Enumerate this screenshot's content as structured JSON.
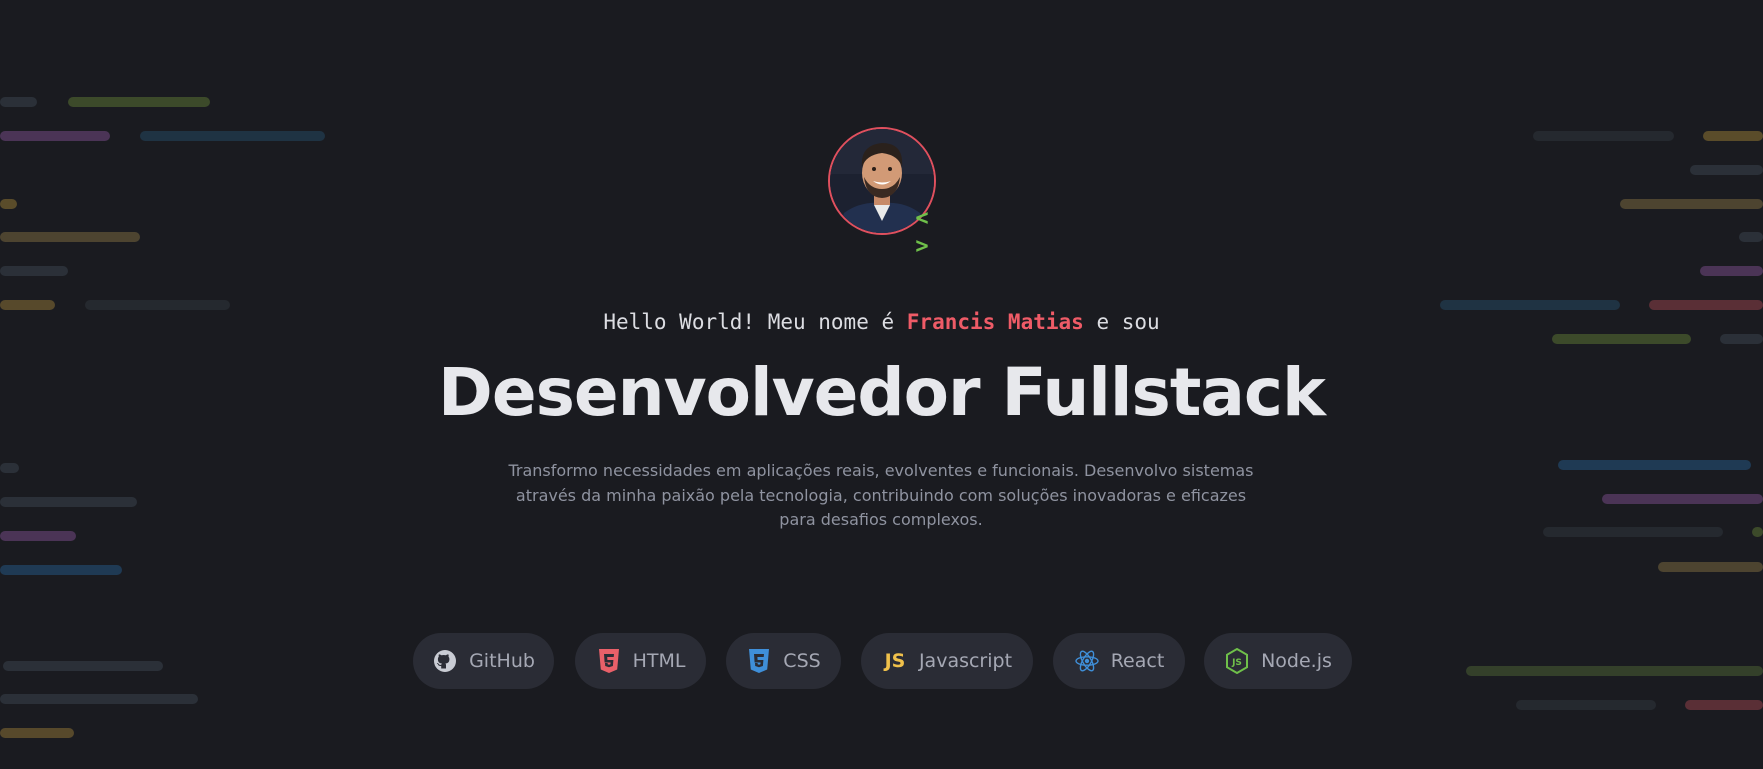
{
  "intro": {
    "prefix": "Hello World! Meu nome é",
    "name": "Francis Matias",
    "suffix": "e sou"
  },
  "title": "Desenvolvedor Fullstack",
  "description": "Transformo necessidades em aplicações reais, evolventes e funcionais. Desenvolvo sistemas através da minha paixão pela tecnologia, contribuindo com soluções inovadoras e eficazes para desafios complexos.",
  "avatar": {
    "badge": "< >"
  },
  "skills": [
    {
      "label": "GitHub",
      "icon": "github-icon"
    },
    {
      "label": "HTML",
      "icon": "html5-icon"
    },
    {
      "label": "CSS",
      "icon": "css3-icon"
    },
    {
      "label": "Javascript",
      "icon": "javascript-icon"
    },
    {
      "label": "React",
      "icon": "react-icon"
    },
    {
      "label": "Node.js",
      "icon": "nodejs-icon"
    }
  ],
  "colors": {
    "background": "#1a1b20",
    "accent": "#ef5b67",
    "chip_background": "#2a2c35",
    "badge": "#6fc04a"
  }
}
